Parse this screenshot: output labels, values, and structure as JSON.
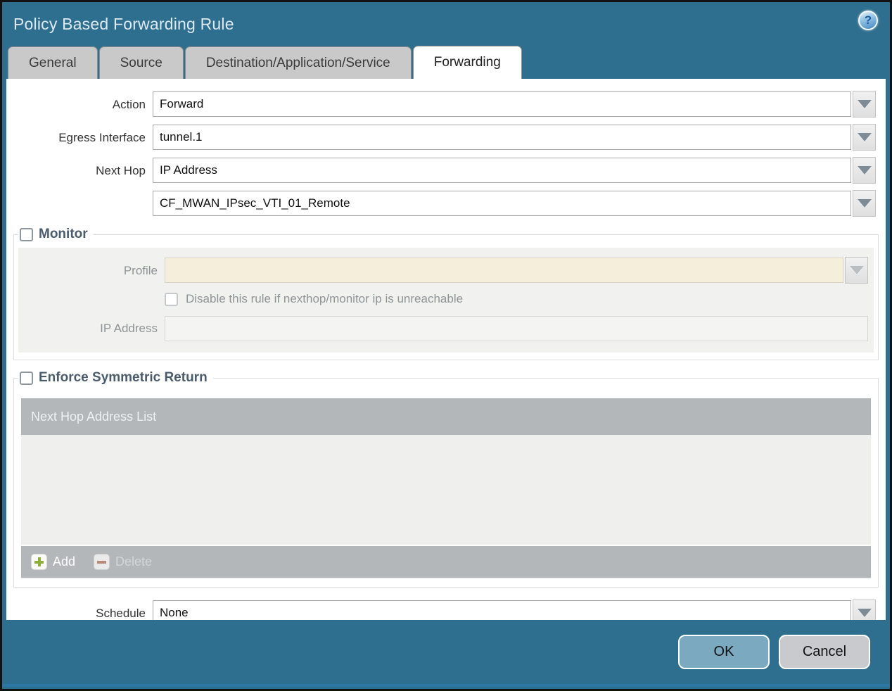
{
  "dialog": {
    "title": "Policy Based Forwarding Rule",
    "help_icon": "?"
  },
  "tabs": [
    {
      "label": "General",
      "active": false
    },
    {
      "label": "Source",
      "active": false
    },
    {
      "label": "Destination/Application/Service",
      "active": false
    },
    {
      "label": "Forwarding",
      "active": true
    }
  ],
  "form": {
    "action": {
      "label": "Action",
      "value": "Forward"
    },
    "egress_interface": {
      "label": "Egress Interface",
      "value": "tunnel.1"
    },
    "next_hop": {
      "label": "Next Hop",
      "type_value": "IP Address",
      "address_value": "CF_MWAN_IPsec_VTI_01_Remote"
    },
    "schedule": {
      "label": "Schedule",
      "value": "None"
    }
  },
  "monitor": {
    "legend": "Monitor",
    "checked": false,
    "profile": {
      "label": "Profile",
      "value": ""
    },
    "disable_rule_checkbox": {
      "label": "Disable this rule if nexthop/monitor ip is unreachable",
      "checked": false
    },
    "ip_address": {
      "label": "IP Address",
      "value": ""
    }
  },
  "symmetric_return": {
    "legend": "Enforce Symmetric Return",
    "checked": false,
    "table": {
      "header": "Next Hop Address List",
      "rows": []
    },
    "add_label": "Add",
    "delete_label": "Delete",
    "delete_enabled": false
  },
  "footer": {
    "ok_label": "OK",
    "cancel_label": "Cancel"
  },
  "colors": {
    "frame_teal": "#2e6f8f",
    "active_tab": "#ffffff",
    "inactive_tab": "#c9c9c9",
    "disabled_panel": "#f1f1ef",
    "profile_field_cream": "#f5eedb",
    "table_gray": "#b3b7ba",
    "ok_button": "#7aa9c0",
    "cancel_button": "#c9cacd",
    "add_plus_green": "#8faf3c",
    "delete_minus_red": "#bb7a68",
    "legend_text": "#4a5b6c"
  }
}
